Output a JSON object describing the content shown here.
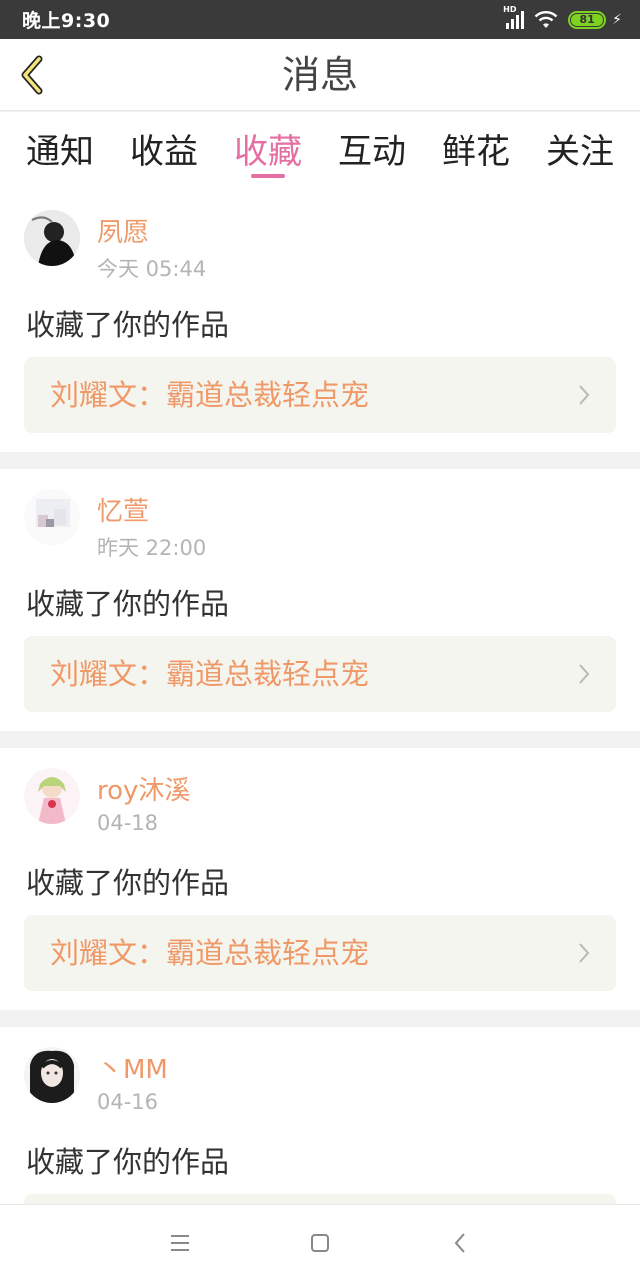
{
  "status_bar": {
    "time": "晚上9:30",
    "network_label": "HD",
    "battery_level": "81"
  },
  "header": {
    "title": "消息",
    "back_icon": "chevron-left-icon"
  },
  "tabs": [
    {
      "label": "通知",
      "active": false
    },
    {
      "label": "收益",
      "active": false
    },
    {
      "label": "收藏",
      "active": true
    },
    {
      "label": "互动",
      "active": false
    },
    {
      "label": "鲜花",
      "active": false
    },
    {
      "label": "关注",
      "active": false
    }
  ],
  "messages": [
    {
      "username": "夙愿",
      "time": "今天 05:44",
      "action": "收藏了你的作品",
      "work": "刘耀文：霸道总裁轻点宠"
    },
    {
      "username": "忆萱",
      "time": "昨天 22:00",
      "action": "收藏了你的作品",
      "work": "刘耀文：霸道总裁轻点宠"
    },
    {
      "username": "roy沐溪",
      "time": "04-18",
      "action": "收藏了你的作品",
      "work": "刘耀文：霸道总裁轻点宠"
    },
    {
      "username": "丶MM",
      "time": "04-16",
      "action": "收藏了你的作品",
      "work": ""
    }
  ],
  "colors": {
    "accent_pink": "#e56fa3",
    "name_orange": "#ef9968",
    "battery_green": "#7ed321"
  },
  "nav_bar": {
    "icons": [
      "menu-icon",
      "home-icon",
      "back-icon"
    ]
  }
}
